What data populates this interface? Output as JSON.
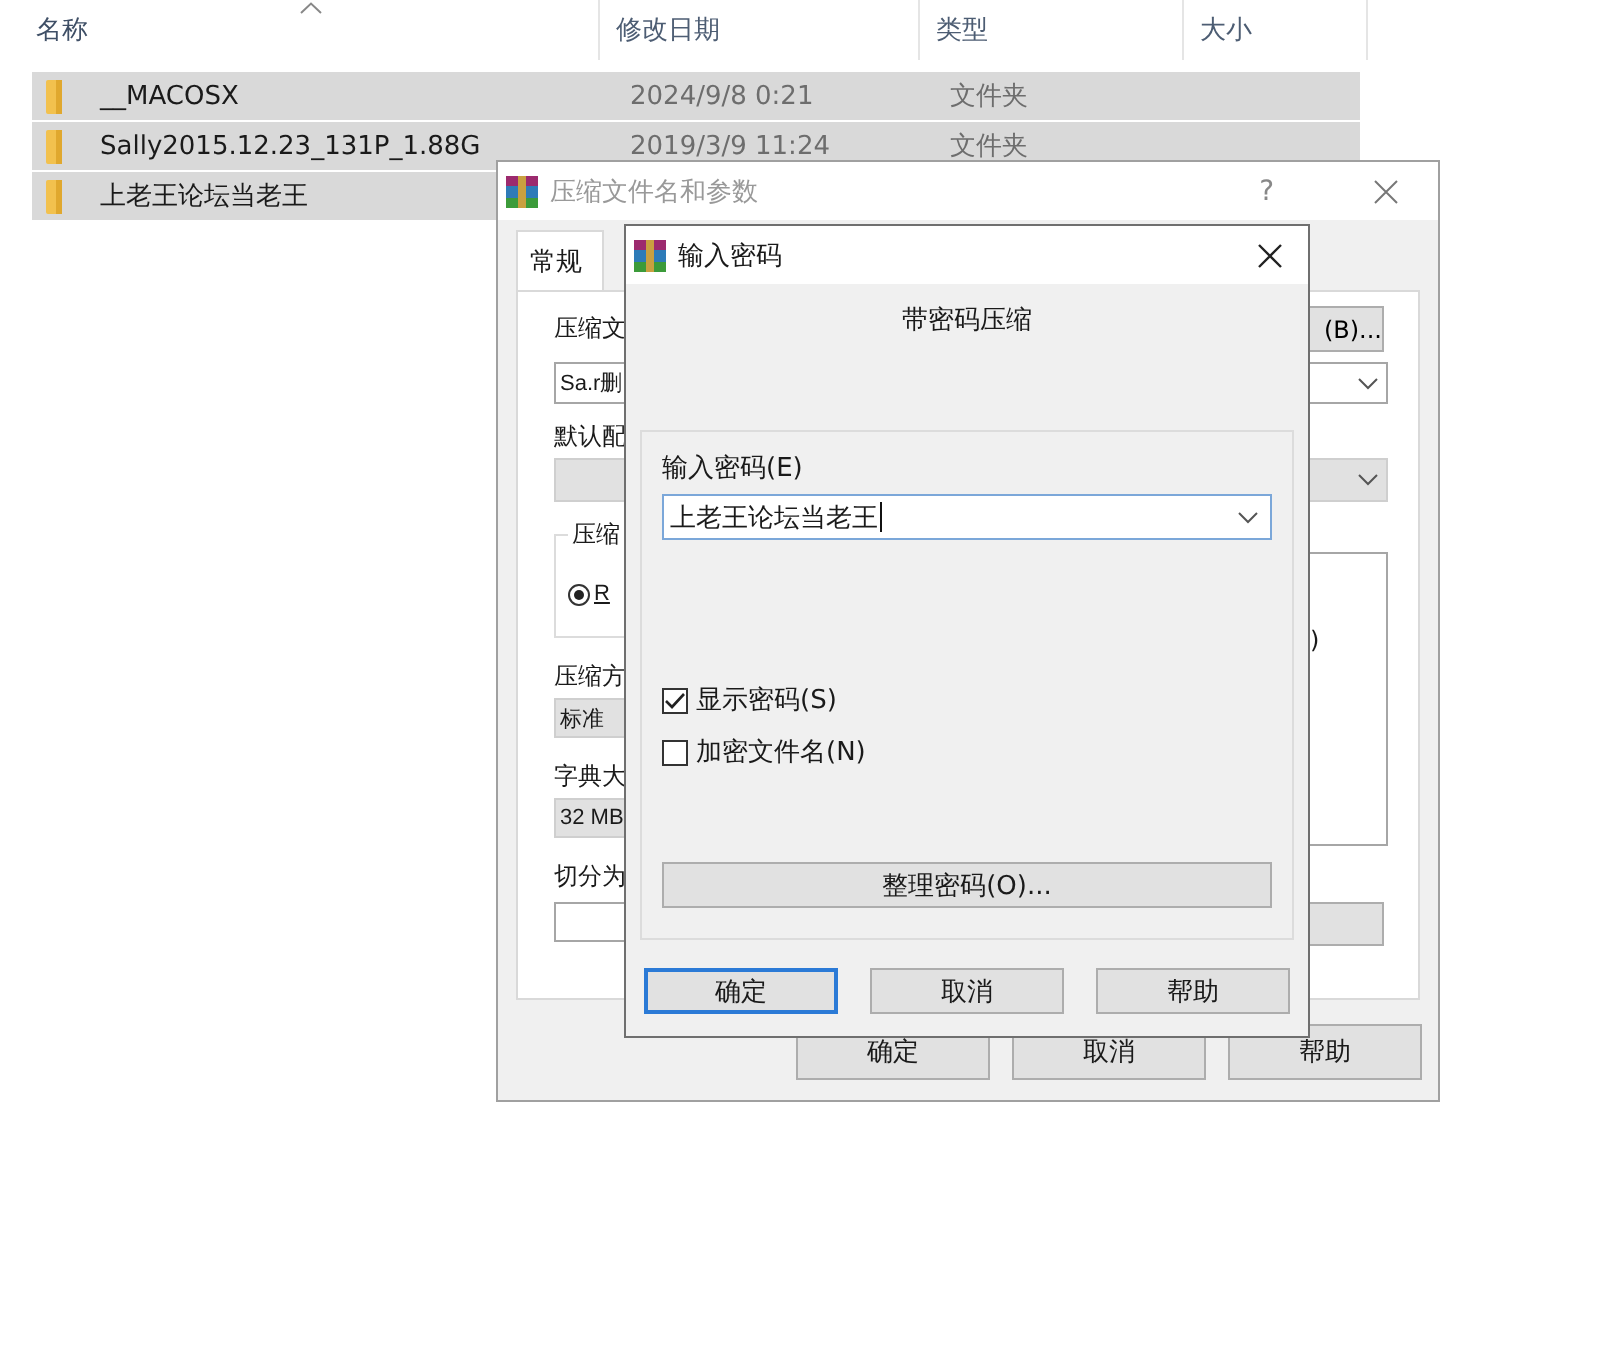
{
  "explorer": {
    "columns": [
      {
        "label": "名称",
        "sorted": true
      },
      {
        "label": "修改日期",
        "sorted": false
      },
      {
        "label": "类型",
        "sorted": false
      },
      {
        "label": "大小",
        "sorted": false
      }
    ],
    "rows": [
      {
        "name": "__MACOSX",
        "date": "2024/9/8 0:21",
        "type": "文件夹",
        "selected": true
      },
      {
        "name": "Sally2015.12.23_131P_1.88G",
        "date": "2019/3/9 11:24",
        "type": "文件夹",
        "selected": true
      },
      {
        "name": "上老王论坛当老王",
        "selected": true
      }
    ]
  },
  "archive_dialog": {
    "title": "压缩文件名和参数",
    "help": "?",
    "tabs": [
      {
        "label": "常规",
        "selected": true
      }
    ],
    "archive_name_label": "压缩文",
    "archive_name_value": "Sa.r删",
    "browse_button": "(B)...",
    "profile_label": "默认配",
    "format_group": "压缩",
    "format_radio": {
      "label": "R",
      "selected": true
    },
    "method_label": "压缩方",
    "method_value": "标准",
    "dict_label": "字典大",
    "dict_value": "32 MB",
    "split_label": "切分为",
    "right_fragment": ")",
    "buttons": [
      "确定",
      "取消",
      "帮助"
    ]
  },
  "password_dialog": {
    "title": "输入密码",
    "heading": "带密码压缩",
    "password_label": "输入密码(E)",
    "password_value": "上老王论坛当老王",
    "options": [
      {
        "label": "显示密码(S)",
        "checked": true
      },
      {
        "label": "加密文件名(N)",
        "checked": false
      }
    ],
    "organize_button": "整理密码(O)...",
    "buttons": [
      {
        "label": "确定",
        "default": true
      },
      {
        "label": "取消",
        "default": false
      },
      {
        "label": "帮助",
        "default": false
      }
    ]
  }
}
